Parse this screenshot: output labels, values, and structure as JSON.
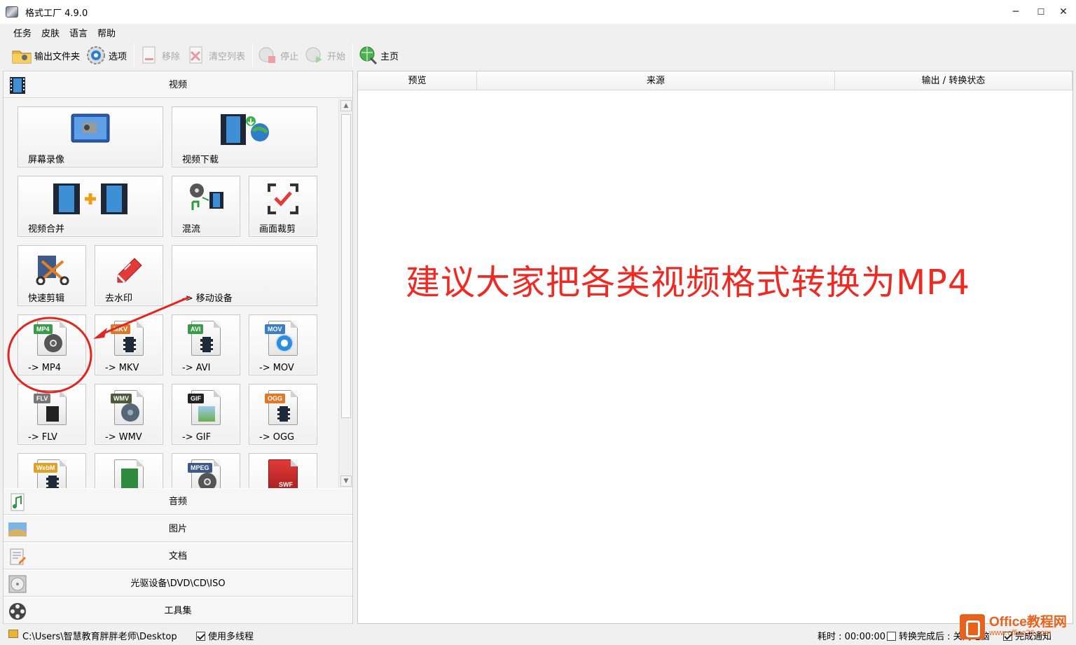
{
  "window": {
    "title": "格式工厂 4.9.0",
    "minimize": "─",
    "maximize": "☐",
    "close": "✕"
  },
  "menu": [
    "任务",
    "皮肤",
    "语言",
    "帮助"
  ],
  "toolbar": {
    "output_folder": "输出文件夹",
    "options": "选项",
    "remove": "移除",
    "clear_list": "清空列表",
    "stop": "停止",
    "start": "开始",
    "home": "主页"
  },
  "categories": {
    "video": "视频",
    "audio": "音频",
    "image": "图片",
    "document": "文档",
    "disc": "光驱设备\\DVD\\CD\\ISO",
    "tools": "工具集"
  },
  "tiles": {
    "screen_record": "屏幕录像",
    "video_download": "视频下载",
    "video_merge": "视频合并",
    "mux": "混流",
    "crop": "画面裁剪",
    "quick_clip": "快速剪辑",
    "remove_watermark": "去水印",
    "mobile": "-> 移动设备",
    "mp4": "-> MP4",
    "mkv": "-> MKV",
    "avi": "-> AVI",
    "mov": "-> MOV",
    "flv": "-> FLV",
    "wmv": "-> WMV",
    "gif": "-> GIF",
    "ogg": "-> OGG"
  },
  "file_tags": {
    "mp4": "MP4",
    "mkv": "MKV",
    "avi": "AVI",
    "mov": "MOV",
    "flv": "FLV",
    "wmv": "WMV",
    "gif": "GIF",
    "ogg": "OGG",
    "webm": "WebM",
    "mpeg": "MPEG",
    "swf": "SWF"
  },
  "columns": {
    "preview": "预览",
    "source": "来源",
    "output_status": "输出 / 转换状态"
  },
  "annotation": "建议大家把各类视频格式转换为MP4",
  "status": {
    "path": "C:\\Users\\智慧教育胖胖老师\\Desktop",
    "multithread": "使用多线程",
    "elapsed": "耗时 : 00:00:00",
    "after_convert": "转换完成后 : 关闭电脑",
    "notify": "完成通知"
  },
  "watermark": {
    "title": "Office教程网",
    "url": "www.office26.com"
  },
  "colors": {
    "annotation": "#ee2a23",
    "watermark": "#e8621d"
  }
}
